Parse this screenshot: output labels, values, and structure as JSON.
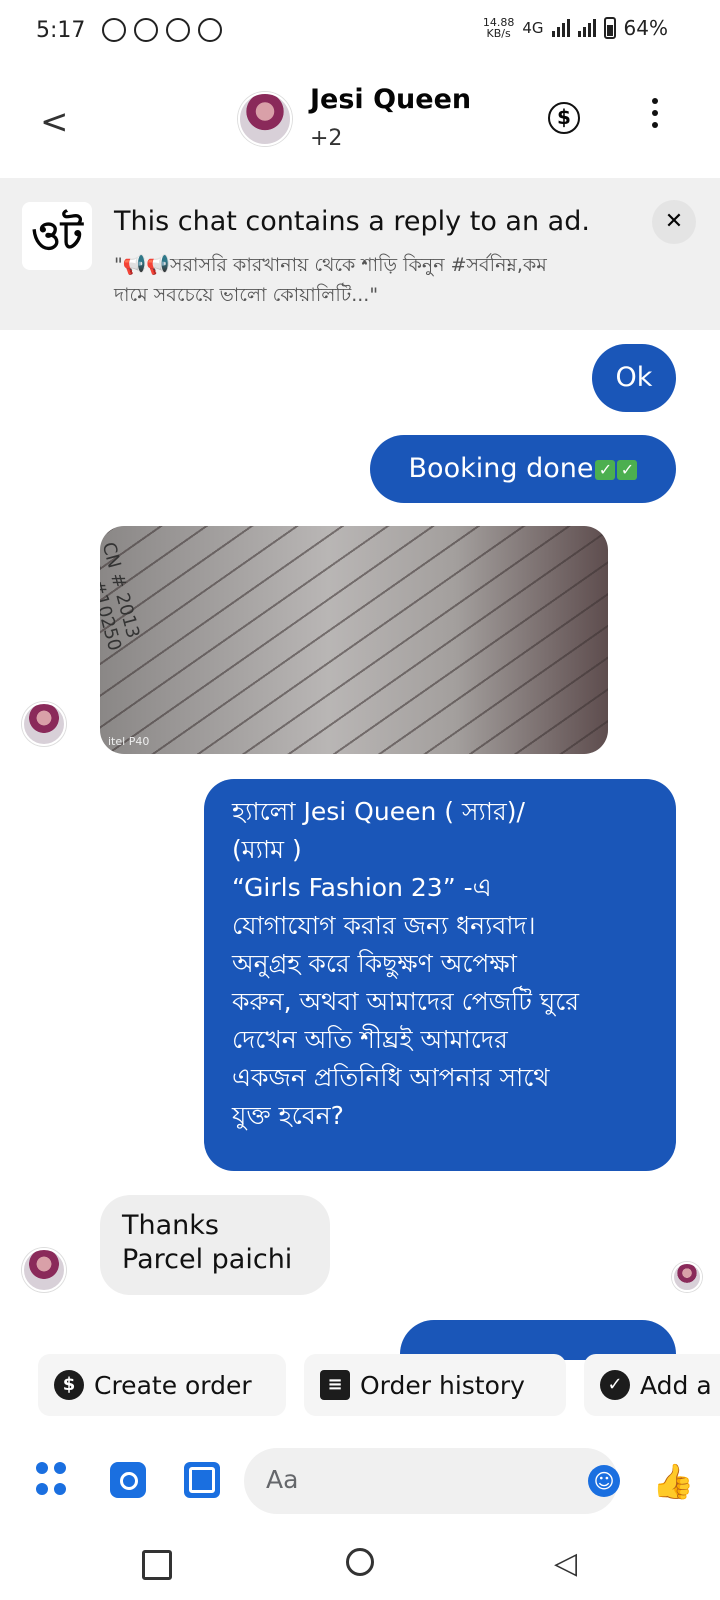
{
  "status_bar": {
    "time": "5:17",
    "speed": "14.88",
    "speed_unit": "KB/s",
    "network": "4G",
    "battery": "64%"
  },
  "header": {
    "name": "Jesi Queen",
    "subtitle": "+2"
  },
  "ad_banner": {
    "logo_text": "ওট",
    "title": "This chat contains a reply to an ad.",
    "quote": "\"📢📢সরাসরি কারখানায় থেকে শাড়ি কিনুন #সর্বনিম্ন,কম দামে সবচেয়ে ভালো কোয়ালিটি...\""
  },
  "messages": {
    "ok": "Ok",
    "booking": "Booking done",
    "photo_text": "CN # 2013\nGD #10250",
    "photo_watermark": "itel P40",
    "greeting": "হ্যালো Jesi Queen ( স্যার)/\n(ম্যাম )\n “Girls Fashion 23” -এ\nযোগাযোগ করার জন্য ধন্যবাদ।\nঅনুগ্রহ করে কিছুক্ষণ অপেক্ষা\nকরুন, অথবা আমাদের পেজটি ঘুরে\nদেখেন  অতি শীঘ্রই  আমাদের\nএকজন প্রতিনিধি আপনার সাথে\nযুক্ত হবেন?",
    "thanks": "Thanks\nParcel paichi"
  },
  "chips": {
    "create_order": "Create order",
    "order_history": "Order history",
    "add": "Add a"
  },
  "composer": {
    "placeholder": "Aa"
  },
  "colors": {
    "accent": "#1a56b8",
    "icon_blue": "#1a6fe0",
    "incoming": "#eeeeee",
    "banner": "#f0f0f0"
  }
}
